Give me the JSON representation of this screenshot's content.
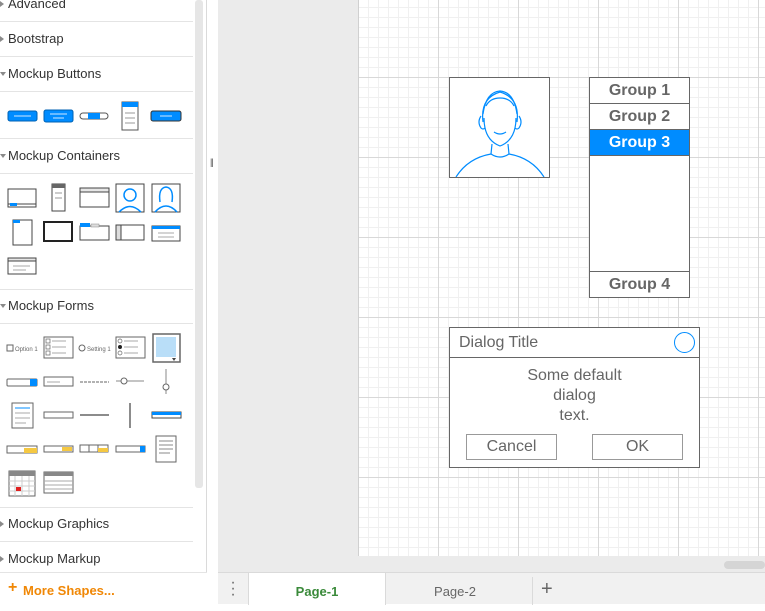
{
  "sidebar": {
    "sections": {
      "advanced": "Advanced",
      "bootstrap": "Bootstrap",
      "mockup_buttons": "Mockup Buttons",
      "mockup_containers": "Mockup Containers",
      "mockup_forms": "Mockup Forms",
      "mockup_graphics": "Mockup Graphics",
      "mockup_markup": "Mockup Markup"
    },
    "forms_labels": {
      "option": "Option 1",
      "setting": "Setting 1"
    },
    "more_shapes": "More Shapes..."
  },
  "canvas": {
    "groups": {
      "group1": "Group 1",
      "group2": "Group 2",
      "group3": "Group 3",
      "group4": "Group 4"
    },
    "dialog": {
      "title": "Dialog Title",
      "text_line1": "Some default",
      "text_line2": "dialog",
      "text_line3": "text.",
      "cancel": "Cancel",
      "ok": "OK"
    }
  },
  "tabs": {
    "page1": "Page-1",
    "page2": "Page-2",
    "add": "+"
  },
  "colors": {
    "accent_blue": "#008cff",
    "more_shapes_orange": "#f08705",
    "active_tab_green": "#3a8a3a"
  }
}
